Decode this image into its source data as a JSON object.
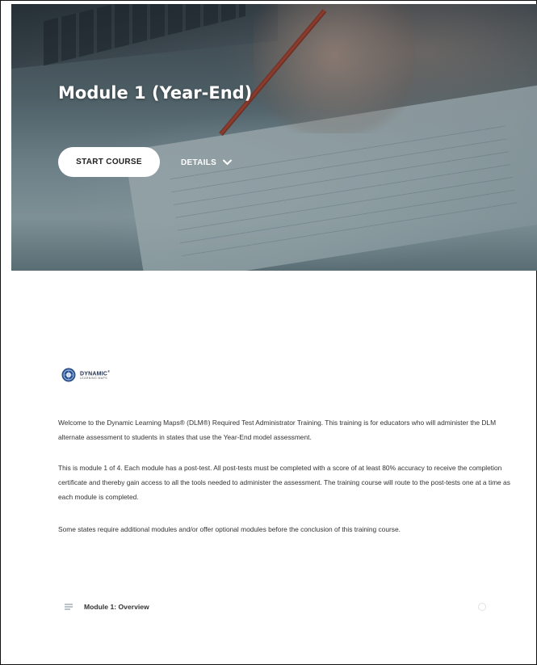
{
  "hero": {
    "title": "Module 1 (Year-End)",
    "start_button_label": "START COURSE",
    "details_label": "DETAILS",
    "image_name": "hand-writing-notes-image"
  },
  "logo": {
    "main": "DYNAMIC",
    "sub": "LEARNING MAPS",
    "mark": "®"
  },
  "description": {
    "p1": "Welcome to the Dynamic Learning Maps® (DLM®) Required Test Administrator Training. This training is for educators who will administer the DLM alternate assessment to students in states that use the Year-End model assessment.",
    "p2": "This is module 1 of 4. Each module has a post-test. All post-tests must be completed with a score of at least 80% accuracy to receive the completion certificate and thereby gain access to all the tools needed to administer the assessment. The training course will route to the post-tests one at a time as each module is completed.",
    "p3": "Some states require additional modules and/or offer optional modules before the conclusion of this training course."
  },
  "modules": [
    {
      "title": "Module 1: Overview",
      "icon": "lines-icon",
      "status_icon": "circle-icon"
    }
  ],
  "colors": {
    "accent_button_bg": "#ffffff",
    "hero_tint": "#1e3a44",
    "body_text": "#333333"
  }
}
